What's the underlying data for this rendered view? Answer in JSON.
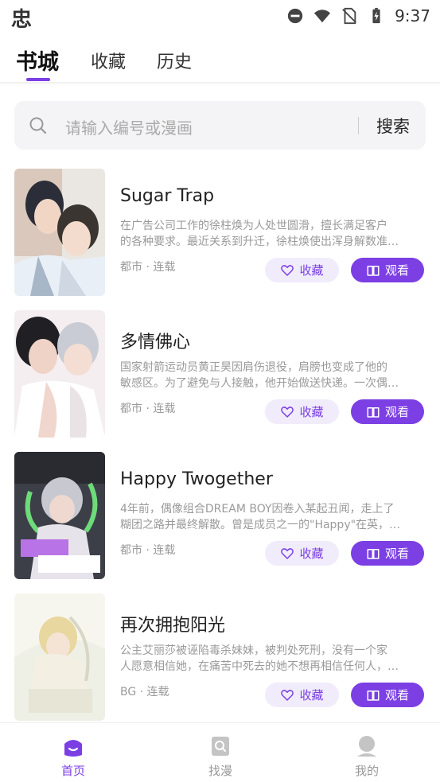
{
  "status_bar": {
    "app_glyph": "忠",
    "time": "9:37",
    "icons": [
      "minus-circle-icon",
      "wifi-icon",
      "no-sim-icon",
      "battery-charging-icon"
    ]
  },
  "top_tabs": [
    {
      "label": "书城",
      "active": true
    },
    {
      "label": "收藏",
      "active": false
    },
    {
      "label": "历史",
      "active": false
    }
  ],
  "search": {
    "placeholder": "请输入编号或漫画",
    "button_label": "搜索"
  },
  "comics": [
    {
      "title": "Sugar Trap",
      "desc_line1": "在广告公司工作的徐柱焕为人处世圆滑，擅长满足客户",
      "desc_line2": "的各种要求。最近关系到升迁，徐柱焕使出浑身解数准…",
      "meta": "都市 · 连载",
      "fav_label": "收藏",
      "watch_label": "观看"
    },
    {
      "title": "多情佛心",
      "desc_line1": "国家射箭运动员黄正昊因肩伤退役，肩膀也变成了他的",
      "desc_line2": "敏感区。为了避免与人接触，他开始做送快递。一次偶…",
      "meta": "都市 · 连载",
      "fav_label": "收藏",
      "watch_label": "观看"
    },
    {
      "title": "Happy Twogether",
      "desc_line1": "4年前，偶像组合DREAM BOY因卷入某起丑闻，走上了",
      "desc_line2": "糊团之路并最终解散。曾是成员之一的\"Happy\"在英，…",
      "meta": "都市 · 连载",
      "fav_label": "收藏",
      "watch_label": "观看"
    },
    {
      "title": "再次拥抱阳光",
      "desc_line1": "公主艾丽莎被诬陷毒杀妹妹，被判处死刑，没有一个家",
      "desc_line2": "人愿意相信她，在痛苦中死去的她不想再相信任何人，…",
      "meta": "BG · 连载",
      "fav_label": "收藏",
      "watch_label": "观看"
    }
  ],
  "bottom_nav": [
    {
      "label": "首页",
      "icon": "home-icon",
      "active": true
    },
    {
      "label": "找漫",
      "icon": "find-comic-icon",
      "active": false
    },
    {
      "label": "我的",
      "icon": "profile-icon",
      "active": false
    }
  ],
  "colors": {
    "accent": "#7b3fe4",
    "accent_light": "#f1ecfb",
    "search_bg": "#f4f4f6",
    "muted_text": "#9a9a9a"
  }
}
